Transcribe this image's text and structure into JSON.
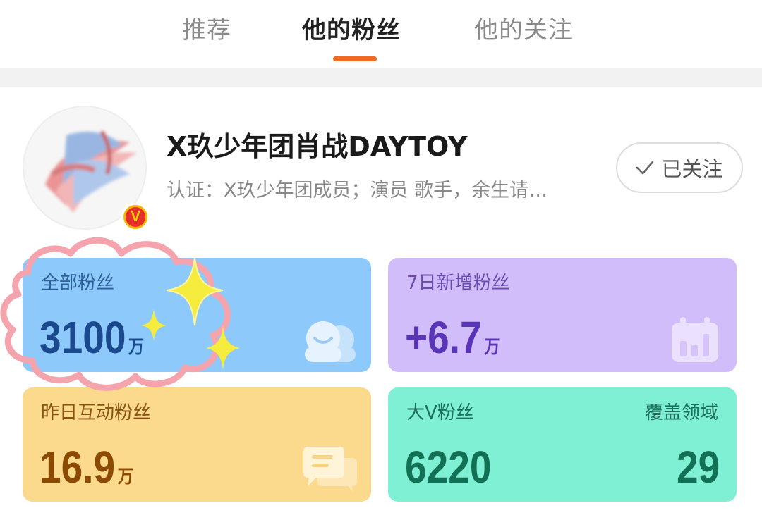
{
  "tabs": [
    {
      "label": "推荐",
      "active": false
    },
    {
      "label": "他的粉丝",
      "active": true
    },
    {
      "label": "他的关注",
      "active": false
    }
  ],
  "accent_color": "#ef6a22",
  "profile": {
    "name": "X玖少年团肖战DAYTOY",
    "verification": "认证：X玖少年团成员；演员 歌手，余生请…",
    "verified_badge": "V",
    "follow_button_label": "已关注",
    "follow_icon": "check-icon"
  },
  "stats": {
    "total_fans": {
      "label": "全部粉丝",
      "value": "3100",
      "unit": "万",
      "icon": "fans-face-icon",
      "color": "#8ec9fb"
    },
    "new_fans_7d": {
      "label": "7日新增粉丝",
      "value": "+6.7",
      "unit": "万",
      "icon": "bar-chart-calendar-icon",
      "color": "#d2bdfb"
    },
    "interactive_fans": {
      "label": "昨日互动粉丝",
      "value": "16.9",
      "unit": "万",
      "icon": "chat-bubbles-icon",
      "color": "#fbd98d"
    },
    "bigv_fans": {
      "label": "大V粉丝",
      "value": "6220",
      "coverage_label": "覆盖领域",
      "coverage_value": "29",
      "color": "#7ff0d4"
    }
  }
}
